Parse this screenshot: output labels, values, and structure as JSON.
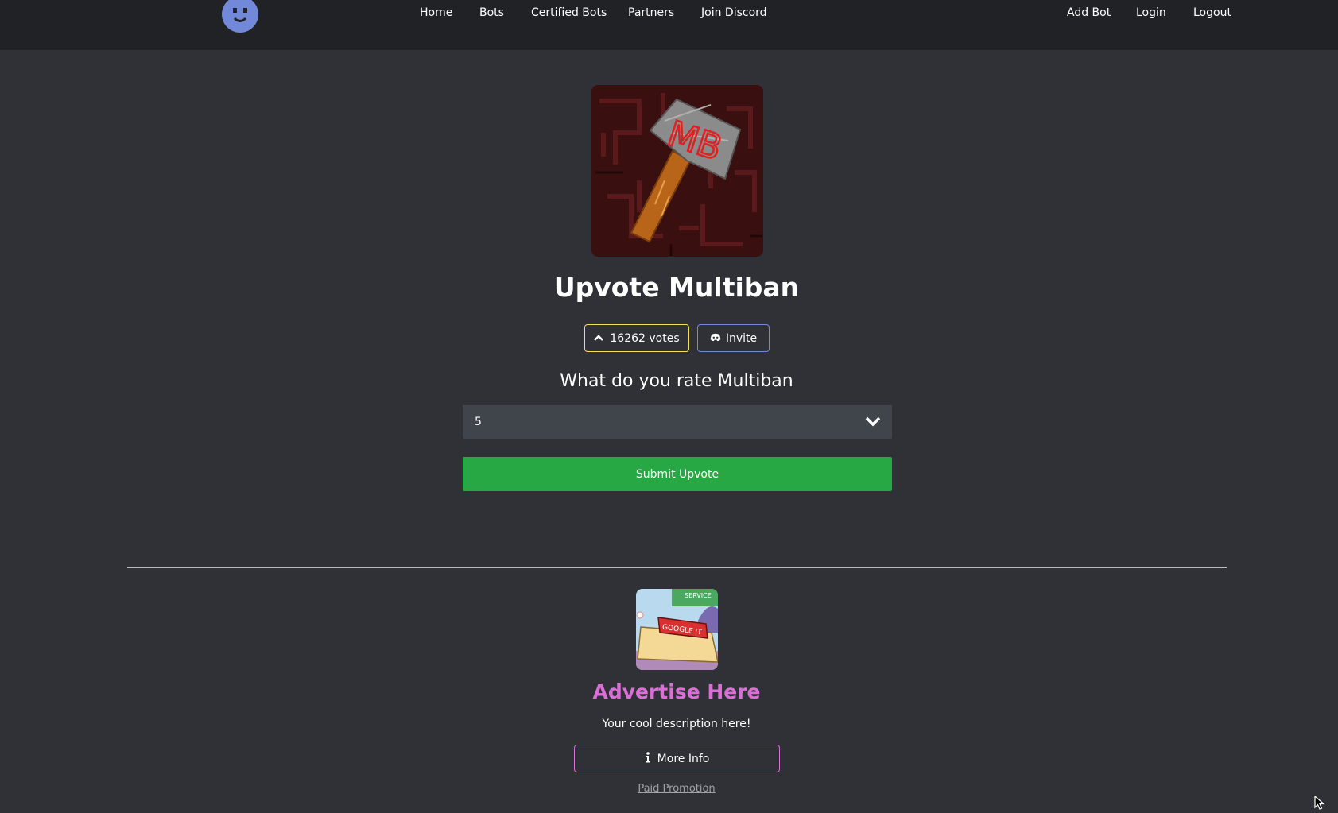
{
  "nav": {
    "links": [
      "Home",
      "Bots",
      "Certified Bots",
      "Partners",
      "Join Discord"
    ],
    "right_links": [
      "Add Bot",
      "Login",
      "Logout"
    ]
  },
  "bot": {
    "name": "Upvote Multiban",
    "avatar_text": "MB",
    "votes_label": "16262 votes",
    "invite_label": "Invite"
  },
  "rating": {
    "heading": "What do you rate Multiban",
    "selected_value": "5",
    "submit_label": "Submit Upvote"
  },
  "ad": {
    "title": "Advertise Here",
    "description": "Your cool description here!",
    "button_label": "More Info",
    "image_sign_text": "GOOGLE IT",
    "image_banner_text": "SERVICE",
    "footer_label": "Paid Promotion"
  },
  "colors": {
    "background": "#2f3136",
    "navbar": "#202225",
    "votes_border": "#f1e05a",
    "invite_border": "#7289da",
    "submit_green": "#28a745",
    "ad_accent": "#da70d6",
    "select_bg": "#40444b"
  },
  "icons": {
    "votes": "chevron-up-icon",
    "invite": "discord-icon",
    "select": "chevron-down-icon",
    "more_info": "info-icon"
  }
}
